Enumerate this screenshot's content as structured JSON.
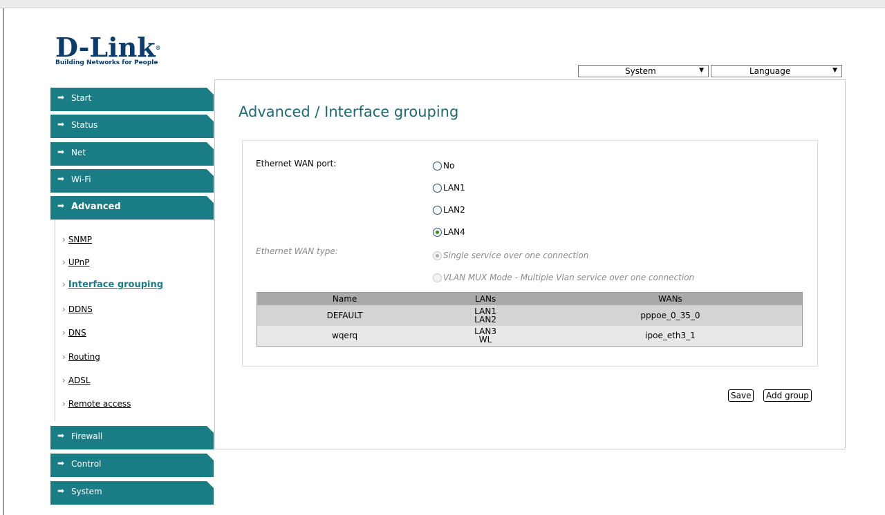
{
  "brand": {
    "name": "D-Link",
    "tagline": "Building Networks for People"
  },
  "header": {
    "system_label": "System",
    "language_label": "Language"
  },
  "sidebar": {
    "items": [
      {
        "label": "Start"
      },
      {
        "label": "Status"
      },
      {
        "label": "Net"
      },
      {
        "label": "Wi-Fi"
      },
      {
        "label": "Advanced"
      },
      {
        "label": "Firewall"
      },
      {
        "label": "Control"
      },
      {
        "label": "System"
      }
    ],
    "subitems": [
      {
        "label": "SNMP"
      },
      {
        "label": "UPnP"
      },
      {
        "label": "Interface grouping"
      },
      {
        "label": "DDNS"
      },
      {
        "label": "DNS"
      },
      {
        "label": "Routing"
      },
      {
        "label": "ADSL"
      },
      {
        "label": "Remote access"
      }
    ]
  },
  "main": {
    "title": "Advanced / Interface grouping",
    "wan_port_label": "Ethernet WAN port:",
    "wan_port_options": [
      "No",
      "LAN1",
      "LAN2",
      "LAN4"
    ],
    "wan_port_selected": "LAN4",
    "wan_type_label": "Ethernet WAN type:",
    "wan_type_options": [
      "Single service over one connection",
      "VLAN MUX Mode - Multiple Vlan service over one connection"
    ],
    "wan_type_selected": "Single service over one connection",
    "table": {
      "headers": [
        "Name",
        "LANs",
        "WANs"
      ],
      "rows": [
        {
          "name": "DEFAULT",
          "lans": [
            "LAN1",
            "LAN2"
          ],
          "wans": "pppoe_0_35_0"
        },
        {
          "name": "wqerq",
          "lans": [
            "LAN3",
            "WL"
          ],
          "wans": "ipoe_eth3_1"
        }
      ]
    },
    "buttons": {
      "save": "Save",
      "add_group": "Add group"
    }
  },
  "colors": {
    "nav_teal": "#1a7d86",
    "title_teal": "#1a6a74",
    "brand_blue": "#0a3d6b",
    "radio_checked": "#2f8a1f"
  },
  "icons": {
    "nav_arrow": "arrow-right-icon",
    "dropdown": "chevron-down-icon"
  }
}
